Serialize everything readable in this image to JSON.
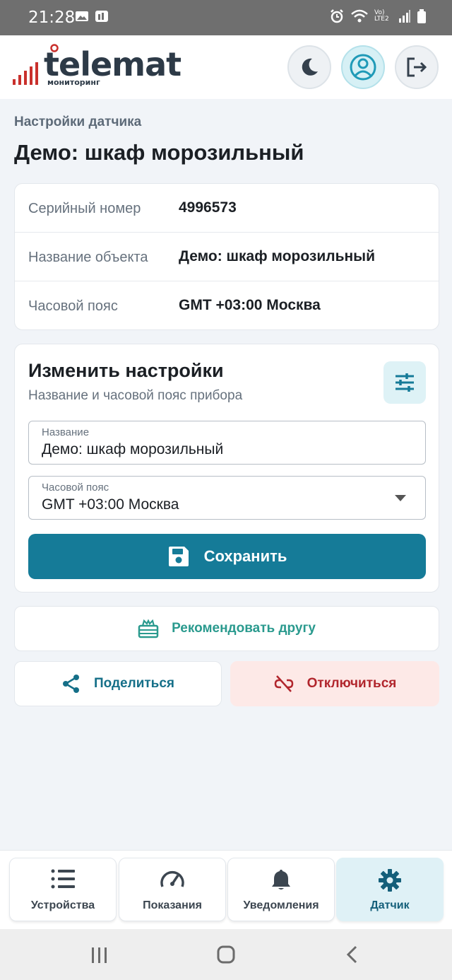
{
  "status_bar": {
    "time": "21:28",
    "lte_label": "Vo) LTE2"
  },
  "header": {
    "logo_word": "telemat",
    "logo_sub": "мониторинг",
    "buttons": [
      "moon-icon",
      "user-icon",
      "logout-icon"
    ]
  },
  "page": {
    "breadcrumb": "Настройки датчика",
    "title": "Демо: шкаф морозильный"
  },
  "info": {
    "rows": [
      {
        "label": "Серийный номер",
        "value": "4996573"
      },
      {
        "label": "Название объекта",
        "value": "Демо: шкаф морозильный"
      },
      {
        "label": "Часовой пояс",
        "value": "GMT +03:00 Москва"
      }
    ]
  },
  "edit": {
    "title": "Изменить настройки",
    "subtitle": "Название и часовой пояс прибора",
    "name_field": {
      "label": "Название",
      "value": "Демо: шкаф морозильный"
    },
    "tz_field": {
      "label": "Часовой пояс",
      "value": "GMT +03:00 Москва"
    },
    "save_label": "Сохранить"
  },
  "actions": {
    "recommend_label": "Рекомендовать другу",
    "share_label": "Поделиться",
    "disconnect_label": "Отключиться"
  },
  "bottom_nav": {
    "tabs": [
      {
        "label": "Устройства",
        "icon": "list-icon"
      },
      {
        "label": "Показания",
        "icon": "gauge-icon"
      },
      {
        "label": "Уведомления",
        "icon": "bell-icon"
      },
      {
        "label": "Датчик",
        "icon": "gear-icon"
      }
    ],
    "active_index": 3
  },
  "colors": {
    "primary": "#157b98",
    "recommend": "#2a9a8e",
    "danger": "#b1262d",
    "danger_bg": "#fde9e7",
    "logo_accent": "#c9302c"
  }
}
